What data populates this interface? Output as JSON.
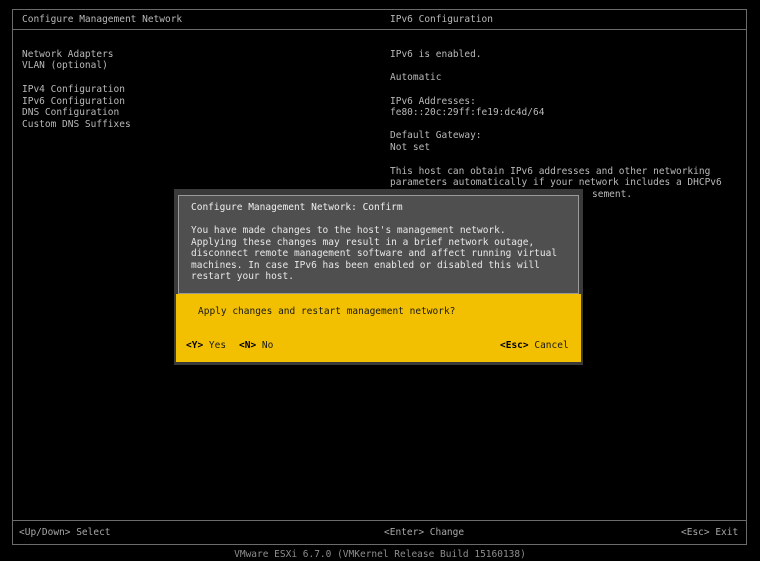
{
  "header": {
    "left_title": "Configure Management Network",
    "right_title": "IPv6 Configuration"
  },
  "menu": {
    "items": [
      "Network Adapters",
      "VLAN (optional)",
      "IPv4 Configuration",
      "IPv6 Configuration",
      "DNS Configuration",
      "Custom DNS Suffixes"
    ]
  },
  "details": {
    "status": "IPv6 is enabled.",
    "mode": "Automatic",
    "addresses_label": "IPv6 Addresses:",
    "address": "fe80::20c:29ff:fe19:dc4d/64",
    "gateway_label": "Default Gateway:",
    "gateway_value": "Not set",
    "note_line1": "This host can obtain IPv6 addresses and other networking",
    "note_line2": "parameters automatically if your network includes a DHCPv6",
    "note_line3": "sement."
  },
  "dialog": {
    "title": "Configure Management Network: Confirm",
    "body": "You have made changes to the host's management network.\nApplying these changes may result in a brief network outage,\ndisconnect remote management software and affect running virtual\nmachines. In case IPv6 has been enabled or disabled this will\nrestart your host.",
    "question": "Apply changes and restart management network?",
    "yes_key": "<Y>",
    "yes_label": "Yes",
    "no_key": "<N>",
    "no_label": "No",
    "cancel_key": "<Esc>",
    "cancel_label": "Cancel"
  },
  "footer": {
    "hint_left": "<Up/Down> Select",
    "hint_center": "<Enter> Change",
    "hint_right": "<Esc> Exit",
    "status_bar": "VMware ESXi 6.7.0 (VMKernel Release Build 15160138)"
  },
  "colors": {
    "background": "#000000",
    "text": "#b9b9b9",
    "dialog_header_bg": "#4f4f4f",
    "dialog_action_bg": "#f2c000"
  }
}
